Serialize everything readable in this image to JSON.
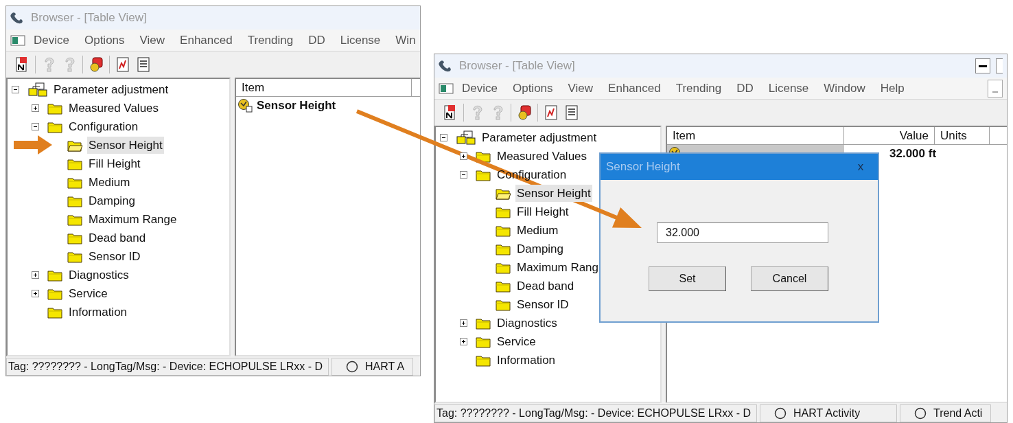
{
  "windows": [
    {
      "title": "Browser - [Table View]",
      "menu": [
        "Device",
        "Options",
        "View",
        "Enhanced",
        "Trending",
        "DD",
        "License",
        "Win"
      ],
      "toolbar": [
        {
          "kind": "device",
          "disabled": false
        },
        {
          "kind": "question",
          "disabled": true
        },
        {
          "kind": "question",
          "disabled": true
        },
        {
          "kind": "help",
          "disabled": false
        },
        {
          "kind": "report",
          "disabled": false
        },
        {
          "kind": "list",
          "disabled": false
        }
      ],
      "tree": {
        "label": "Parameter adjustment",
        "expanded": true,
        "selected": false,
        "children": [
          {
            "label": "Measured Values",
            "expanded": false,
            "selected": false
          },
          {
            "label": "Configuration",
            "expanded": true,
            "selected": false,
            "children": [
              {
                "label": "Sensor Height",
                "selected": true
              },
              {
                "label": "Fill Height",
                "selected": false
              },
              {
                "label": "Medium",
                "selected": false
              },
              {
                "label": "Damping",
                "selected": false
              },
              {
                "label": "Maximum Range",
                "selected": false
              },
              {
                "label": "Dead band",
                "selected": false
              },
              {
                "label": "Sensor ID",
                "selected": false
              }
            ]
          },
          {
            "label": "Diagnostics",
            "expanded": false,
            "selected": false
          },
          {
            "label": "Service",
            "expanded": false,
            "selected": false
          },
          {
            "label": "Information",
            "selected": false
          }
        ]
      },
      "table": {
        "columns": [
          "Item"
        ],
        "rows": [
          {
            "item": "Sensor Height",
            "selected": false
          }
        ]
      },
      "status_bar": [
        "Tag: ???????? - LongTag/Msg:  - Device: ECHOPULSE LRxx - D",
        "HART A"
      ]
    },
    {
      "title": "Browser - [Table View]",
      "menu": [
        "Device",
        "Options",
        "View",
        "Enhanced",
        "Trending",
        "DD",
        "License",
        "Window",
        "Help"
      ],
      "toolbar": [
        {
          "kind": "device",
          "disabled": false
        },
        {
          "kind": "question",
          "disabled": true
        },
        {
          "kind": "question",
          "disabled": true
        },
        {
          "kind": "help",
          "disabled": false
        },
        {
          "kind": "report",
          "disabled": false
        },
        {
          "kind": "list",
          "disabled": false
        }
      ],
      "tree": {
        "label": "Parameter adjustment",
        "expanded": true,
        "selected": false,
        "children": [
          {
            "label": "Measured Values",
            "expanded": false,
            "selected": false
          },
          {
            "label": "Configuration",
            "expanded": true,
            "selected": false,
            "children": [
              {
                "label": "Sensor Height",
                "selected": true
              },
              {
                "label": "Fill Height",
                "selected": false
              },
              {
                "label": "Medium",
                "selected": false
              },
              {
                "label": "Damping",
                "selected": false
              },
              {
                "label": "Maximum Rang",
                "selected": false
              },
              {
                "label": "Dead band",
                "selected": false
              },
              {
                "label": "Sensor ID",
                "selected": false
              }
            ]
          },
          {
            "label": "Diagnostics",
            "expanded": false,
            "selected": false
          },
          {
            "label": "Service",
            "expanded": false,
            "selected": false
          },
          {
            "label": "Information",
            "selected": false
          }
        ]
      },
      "table": {
        "columns": [
          "Item",
          "Value",
          "Units"
        ],
        "rows": [
          {
            "value": "32.000 ft",
            "selected": true
          }
        ]
      },
      "status_bar": [
        "Tag: ???????? - LongTag/Msg:  - Device: ECHOPULSE LRxx - D",
        "HART Activity",
        "Trend Acti"
      ]
    }
  ],
  "dialog": {
    "title": "Sensor Height",
    "close": "x",
    "value": "32.000",
    "buttons": [
      "Set",
      "Cancel"
    ]
  }
}
